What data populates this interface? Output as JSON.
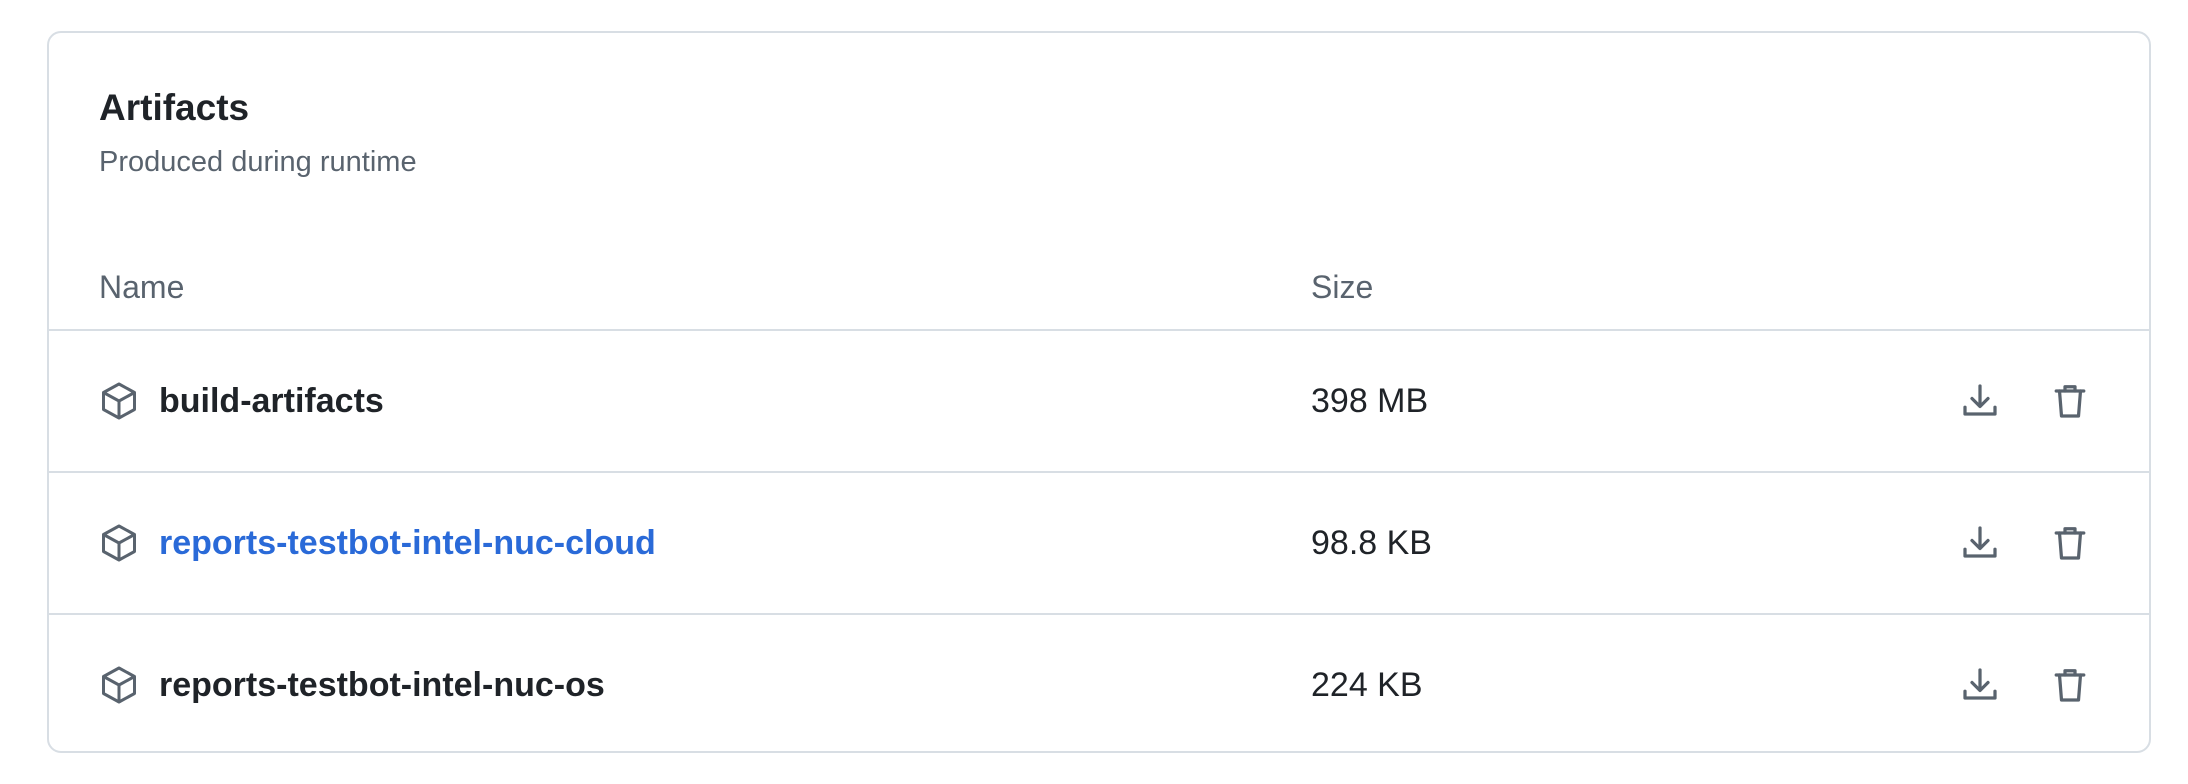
{
  "panel": {
    "title": "Artifacts",
    "subtitle": "Produced during runtime"
  },
  "columns": {
    "name": "Name",
    "size": "Size"
  },
  "artifacts": [
    {
      "name": "build-artifacts",
      "size": "398 MB",
      "is_link": false,
      "icon": "package-icon"
    },
    {
      "name": "reports-testbot-intel-nuc-cloud",
      "size": "98.8 KB",
      "is_link": true,
      "icon": "package-icon"
    },
    {
      "name": "reports-testbot-intel-nuc-os",
      "size": "224 KB",
      "is_link": false,
      "icon": "package-icon"
    }
  ],
  "actions": {
    "download_icon": "download-icon",
    "delete_icon": "trash-icon"
  },
  "colors": {
    "text": "#1f2328",
    "muted": "#59636e",
    "link": "#2a6ad8",
    "border": "#d8dee4"
  }
}
